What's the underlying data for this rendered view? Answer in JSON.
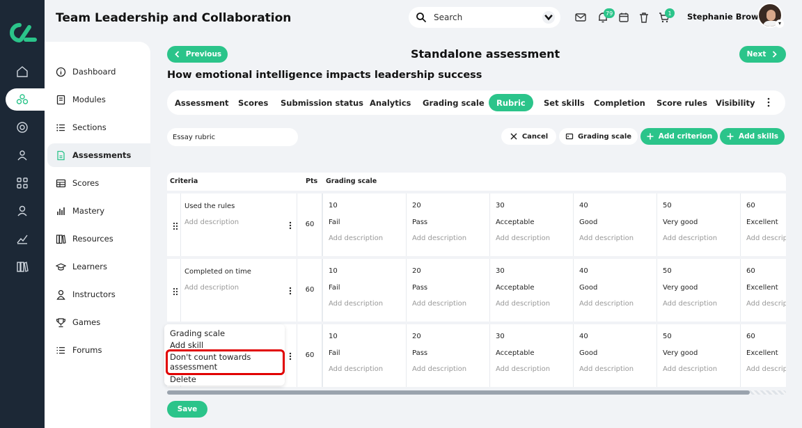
{
  "app": {
    "title": "Team Leadership and Collaboration"
  },
  "header": {
    "search_placeholder": "Search",
    "notifications_badge": "79",
    "cart_badge": "1",
    "user_name": "Stephanie Brown"
  },
  "sidebar": {
    "items": [
      {
        "label": "Dashboard",
        "icon": "info-icon"
      },
      {
        "label": "Modules",
        "icon": "book-icon"
      },
      {
        "label": "Sections",
        "icon": "list-icon"
      },
      {
        "label": "Assessments",
        "icon": "document-icon",
        "active": true
      },
      {
        "label": "Scores",
        "icon": "table-icon"
      },
      {
        "label": "Mastery",
        "icon": "bar-chart-icon"
      },
      {
        "label": "Resources",
        "icon": "books-icon"
      },
      {
        "label": "Learners",
        "icon": "graduation-icon"
      },
      {
        "label": "Instructors",
        "icon": "person-icon"
      },
      {
        "label": "Games",
        "icon": "trophy-icon"
      },
      {
        "label": "Forums",
        "icon": "bullet-list-icon"
      }
    ]
  },
  "page": {
    "title": "Standalone assessment",
    "subtitle": "How emotional intelligence impacts leadership success",
    "previous_label": "Previous",
    "next_label": "Next"
  },
  "tabs": [
    "Assessment",
    "Scores",
    "Submission status",
    "Analytics",
    "Grading scale",
    "Rubric",
    "Set skills",
    "Completion",
    "Score rules",
    "Visibility"
  ],
  "active_tab": "Rubric",
  "toolbar": {
    "rubric_name": "Essay rubric",
    "cancel_label": "Cancel",
    "grading_scale_label": "Grading scale",
    "add_criterion_label": "Add criterion",
    "add_skills_label": "Add skills"
  },
  "grid": {
    "headers": {
      "criteria": "Criteria",
      "pts": "Pts",
      "grading_scale": "Grading scale"
    },
    "levels": [
      {
        "value": "10",
        "name": "Fail"
      },
      {
        "value": "20",
        "name": "Pass"
      },
      {
        "value": "30",
        "name": "Acceptable"
      },
      {
        "value": "40",
        "name": "Good"
      },
      {
        "value": "50",
        "name": "Very good"
      },
      {
        "value": "60",
        "name": "Excellent"
      }
    ],
    "level_description_placeholder": "Add description",
    "rows": [
      {
        "title": "Used the rules",
        "description_placeholder": "Add description",
        "pts": "60"
      },
      {
        "title": "Completed on time",
        "description_placeholder": "Add description",
        "pts": "60"
      },
      {
        "title": "",
        "description_placeholder": "",
        "pts": "60"
      }
    ]
  },
  "context_menu": {
    "items": [
      "Grading scale",
      "Add skill",
      "Don't count towards assessment",
      "Delete"
    ]
  },
  "footer": {
    "save_label": "Save"
  },
  "colors": {
    "accent": "#2bc48a",
    "rail": "#1c2836",
    "highlight": "#e10000"
  }
}
